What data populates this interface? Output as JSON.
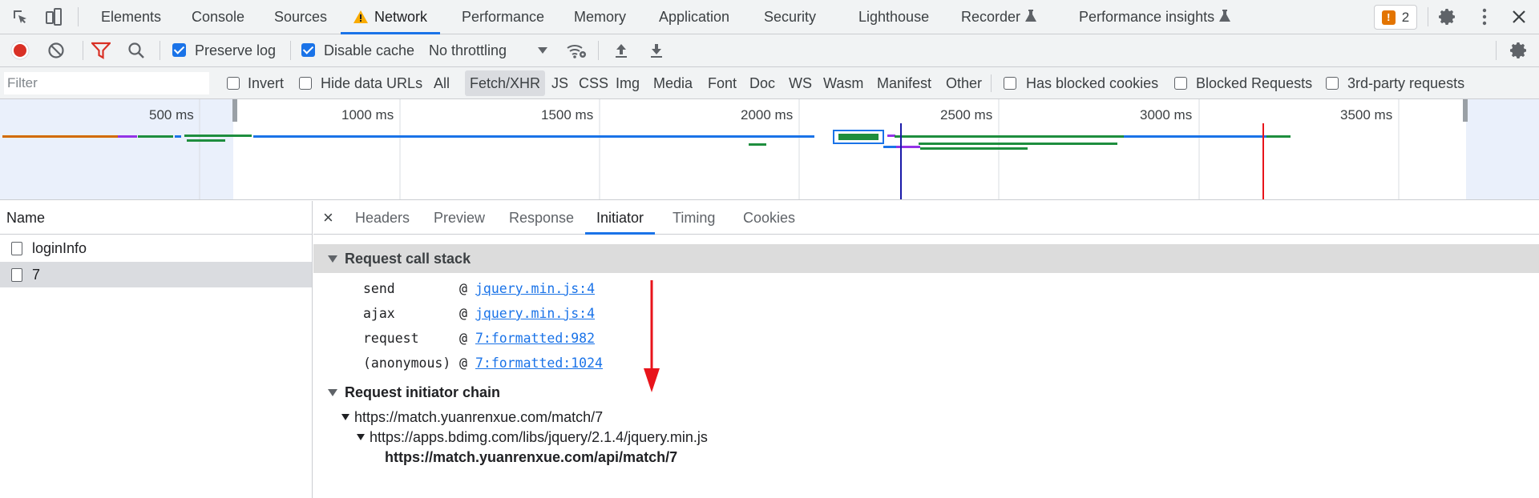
{
  "tabs": [
    {
      "label": "Elements"
    },
    {
      "label": "Console"
    },
    {
      "label": "Sources"
    },
    {
      "label": "Network"
    },
    {
      "label": "Performance"
    },
    {
      "label": "Memory"
    },
    {
      "label": "Application"
    },
    {
      "label": "Security"
    },
    {
      "label": "Lighthouse"
    },
    {
      "label": "Recorder"
    },
    {
      "label": "Performance insights"
    }
  ],
  "active_tab": "Network",
  "issues_count": "2",
  "toolbar": {
    "preserve_log_label": "Preserve log",
    "preserve_log_checked": true,
    "disable_cache_label": "Disable cache",
    "disable_cache_checked": true,
    "throttling_value": "No throttling"
  },
  "filter": {
    "placeholder": "Filter",
    "invert_label": "Invert",
    "hide_data_urls_label": "Hide data URLs",
    "types": [
      "All",
      "Fetch/XHR",
      "JS",
      "CSS",
      "Img",
      "Media",
      "Font",
      "Doc",
      "WS",
      "Wasm",
      "Manifest",
      "Other"
    ],
    "selected_type": "Fetch/XHR",
    "has_blocked_cookies_label": "Has blocked cookies",
    "blocked_requests_label": "Blocked Requests",
    "third_party_label": "3rd-party requests"
  },
  "overview": {
    "ticks": [
      "500 ms",
      "1000 ms",
      "1500 ms",
      "2000 ms",
      "2500 ms",
      "3000 ms",
      "3500 ms"
    ],
    "colors": {
      "waiting": "#1a73e8",
      "download": "#1e8e3e",
      "other": "#d26b00",
      "purple": "#9334e6",
      "dom_line": "#1a1aa8",
      "load_line": "#e8141b"
    }
  },
  "requests": {
    "column_header": "Name",
    "rows": [
      {
        "name": "loginInfo",
        "selected": false
      },
      {
        "name": "7",
        "selected": true
      }
    ]
  },
  "detail": {
    "tabs": [
      "Headers",
      "Preview",
      "Response",
      "Initiator",
      "Timing",
      "Cookies"
    ],
    "active_tab": "Initiator",
    "call_stack_title": "Request call stack",
    "call_stack": [
      {
        "fn": "send",
        "at": "@",
        "link": "jquery.min.js:4"
      },
      {
        "fn": "ajax",
        "at": "@",
        "link": "jquery.min.js:4"
      },
      {
        "fn": "request",
        "at": "@",
        "link": "7:formatted:982"
      },
      {
        "fn": "(anonymous)",
        "at": "@",
        "link": "7:formatted:1024"
      }
    ],
    "chain_title": "Request initiator chain",
    "chain": [
      {
        "url": "https://match.yuanrenxue.com/match/7"
      },
      {
        "url": "https://apps.bdimg.com/libs/jquery/2.1.4/jquery.min.js"
      },
      {
        "url": "https://match.yuanrenxue.com/api/match/7"
      }
    ]
  },
  "annotation": {
    "color": "#e8141b"
  }
}
